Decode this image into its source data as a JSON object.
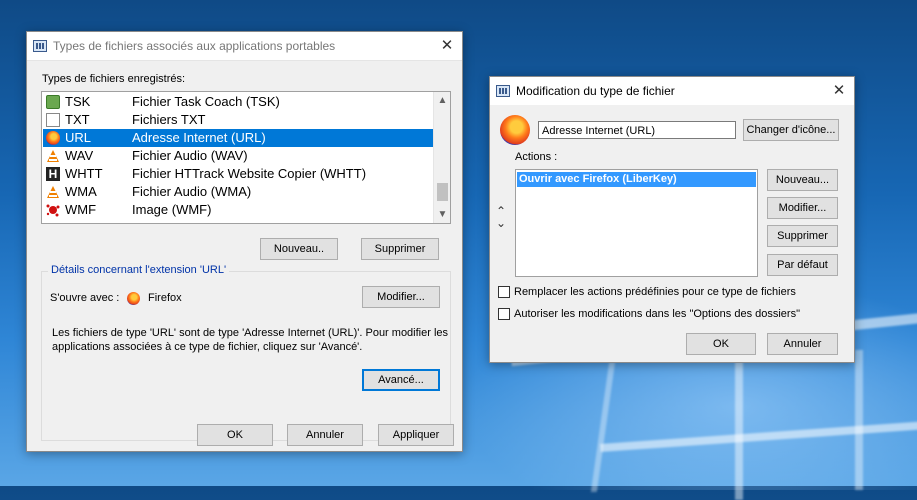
{
  "left_window": {
    "title": "Types de fichiers associés aux applications portables",
    "registered_label": "Types de fichiers enregistrés:",
    "file_types": [
      {
        "ext": "TSK",
        "desc": "Fichier Task Coach (TSK)",
        "icon": "taskcoach-icon"
      },
      {
        "ext": "TXT",
        "desc": "Fichiers TXT",
        "icon": "text-file-icon"
      },
      {
        "ext": "URL",
        "desc": "Adresse Internet (URL)",
        "icon": "firefox-icon",
        "selected": true
      },
      {
        "ext": "WAV",
        "desc": "Fichier Audio (WAV)",
        "icon": "vlc-icon"
      },
      {
        "ext": "WHTT",
        "desc": "Fichier HTTrack Website Copier (WHTT)",
        "icon": "httrack-icon"
      },
      {
        "ext": "WMA",
        "desc": "Fichier Audio (WMA)",
        "icon": "vlc-icon"
      },
      {
        "ext": "WMF",
        "desc": "Image (WMF)",
        "icon": "paint-splash-icon"
      }
    ],
    "new_button": "Nouveau..",
    "delete_button": "Supprimer",
    "details_title": "Détails concernant l'extension 'URL'",
    "opens_with_label": "S'ouvre avec :",
    "opens_with_app": "Firefox",
    "modify_button": "Modifier...",
    "info_line1": "Les fichiers de type 'URL' sont de type 'Adresse Internet (URL)'. Pour modifier les",
    "info_line2": "applications associées à ce type de fichier, cliquez sur 'Avancé'.",
    "advanced_button": "Avancé...",
    "ok_button": "OK",
    "cancel_button": "Annuler",
    "apply_button": "Appliquer"
  },
  "right_window": {
    "title": "Modification du type de fichier",
    "name_value": "Adresse Internet (URL)",
    "change_icon_button": "Changer d'icône...",
    "actions_label": "Actions :",
    "actions": [
      "Ouvrir avec Firefox (LiberKey)"
    ],
    "new_button": "Nouveau...",
    "modify_button": "Modifier...",
    "delete_button": "Supprimer",
    "default_button": "Par défaut",
    "checkbox1": "Remplacer les actions prédéfinies pour ce type de fichiers",
    "checkbox2": "Autoriser les modifications dans les \"Options des dossiers\"",
    "ok_button": "OK",
    "cancel_button": "Annuler"
  },
  "colors": {
    "selection": "#0078d7",
    "action_selection": "#3399ff",
    "group_title": "#0033a8"
  }
}
